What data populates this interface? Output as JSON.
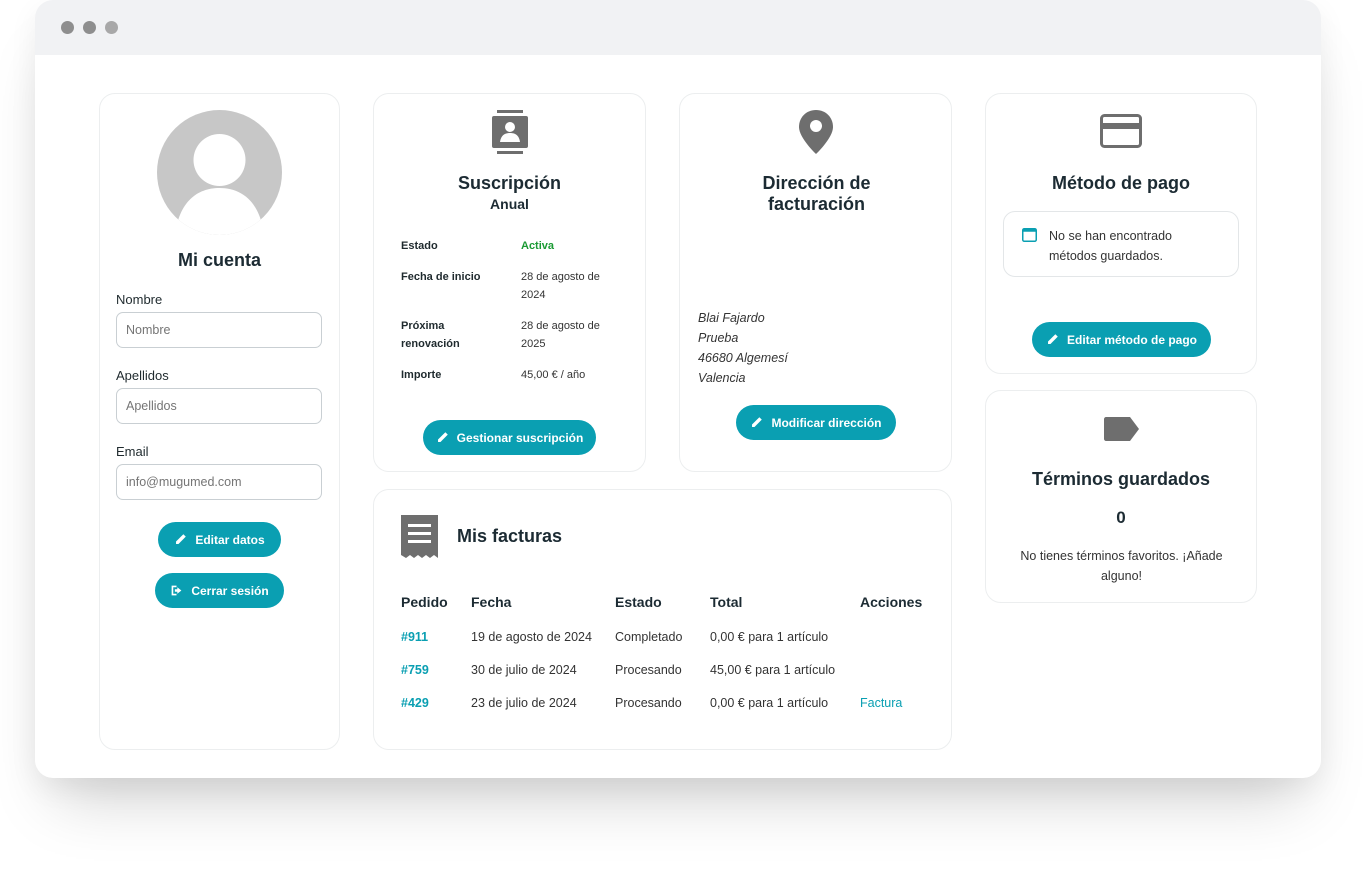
{
  "account": {
    "title": "Mi cuenta",
    "nombre_label": "Nombre",
    "nombre_placeholder": "Nombre",
    "apellidos_label": "Apellidos",
    "apellidos_placeholder": "Apellidos",
    "email_label": "Email",
    "email_placeholder": "info@mugumed.com",
    "edit_button": "Editar datos",
    "logout_button": "Cerrar sesión"
  },
  "subscription": {
    "title": "Suscripción",
    "subtitle": "Anual",
    "rows": [
      {
        "key": "Estado",
        "value": "Activa"
      },
      {
        "key": "Fecha de inicio",
        "value": "28 de agosto de 2024"
      },
      {
        "key": "Próxima renovación",
        "value": "28 de agosto de 2025"
      },
      {
        "key": "Importe",
        "value": "45,00 € / año"
      }
    ],
    "manage_button": "Gestionar suscripción",
    "status_color": "#1a9a33"
  },
  "billing_address": {
    "title": "Dirección de facturación",
    "lines": [
      "Blai Fajardo",
      "Prueba",
      "46680 Algemesí",
      "Valencia"
    ],
    "edit_button": "Modificar dirección"
  },
  "payment": {
    "title": "Método de pago",
    "notice": "No se han encontrado métodos guardados.",
    "edit_button": "Editar método de pago"
  },
  "terms": {
    "title": "Términos guardados",
    "count": "0",
    "message": "No tienes términos favoritos. ¡Añade alguno!"
  },
  "invoices": {
    "title": "Mis facturas",
    "columns": [
      "Pedido",
      "Fecha",
      "Estado",
      "Total",
      "Acciones"
    ],
    "rows": [
      {
        "order": "#911",
        "date": "19 de agosto de 2024",
        "status": "Completado",
        "total": "0,00 € para 1 artículo",
        "action": ""
      },
      {
        "order": "#759",
        "date": "30 de julio de 2024",
        "status": "Procesando",
        "total": "45,00 € para 1 artículo",
        "action": ""
      },
      {
        "order": "#429",
        "date": "23 de julio de 2024",
        "status": "Procesando",
        "total": "0,00 € para 1 artículo",
        "action": "Factura"
      }
    ]
  },
  "icons": {
    "subscription": "contact-card-icon",
    "address": "map-pin-icon",
    "payment": "credit-card-icon",
    "terms": "tag-icon",
    "invoices": "receipt-icon"
  },
  "colors": {
    "accent": "#0a9fb2",
    "icon_gray": "#6e6e6e"
  }
}
